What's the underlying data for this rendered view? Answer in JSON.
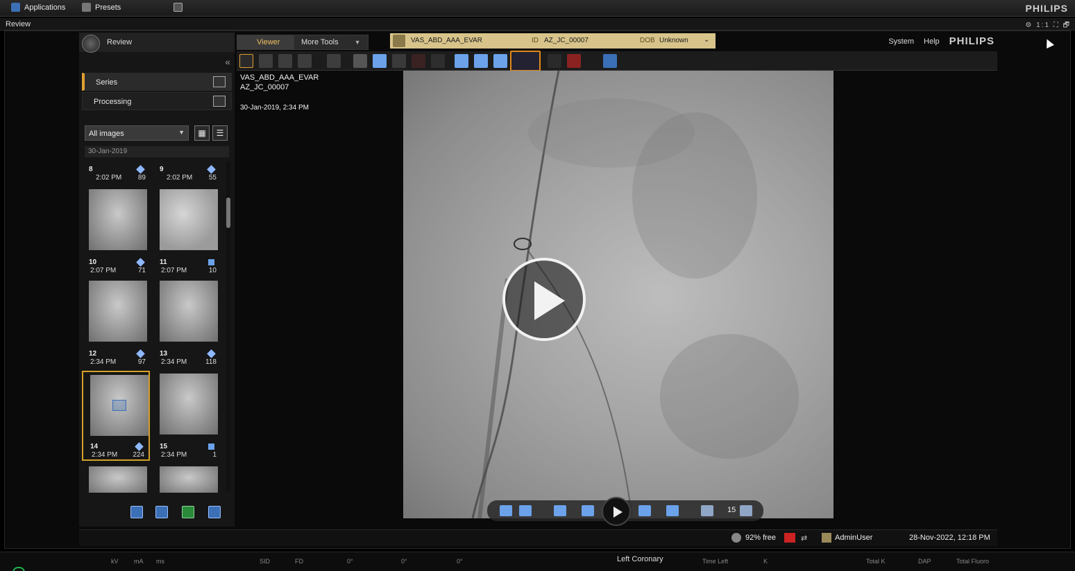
{
  "topbar": {
    "applications": "Applications",
    "presets": "Presets",
    "brand": "PHILIPS"
  },
  "reviewbar": {
    "label": "Review",
    "controls": "⚙ 1:1 ⛶ 🗗"
  },
  "left_panel": {
    "title": "Review",
    "nav": [
      {
        "label": "Series"
      },
      {
        "label": "Processing"
      }
    ],
    "filter": "All images",
    "date": "30-Jan-2019",
    "thumbs": [
      {
        "num": "8",
        "time": "2:02 PM",
        "count": "89"
      },
      {
        "num": "9",
        "time": "2:02 PM",
        "count": "55"
      },
      {
        "num": "10",
        "time": "2:07 PM",
        "count": "71"
      },
      {
        "num": "11",
        "time": "2:07 PM",
        "count": "10"
      },
      {
        "num": "12",
        "time": "2:34 PM",
        "count": "97"
      },
      {
        "num": "13",
        "time": "2:34 PM",
        "count": "118"
      },
      {
        "num": "14",
        "time": "2:34 PM",
        "count": "224"
      },
      {
        "num": "15",
        "time": "2:34 PM",
        "count": "1"
      }
    ]
  },
  "tabs": {
    "viewer": "Viewer",
    "more_tools": "More Tools"
  },
  "patient": {
    "name": "VAS_ABD_AAA_EVAR",
    "id_label": "ID",
    "id": "AZ_JC_00007",
    "dob_label": "DOB",
    "dob": "Unknown"
  },
  "topright": {
    "system": "System",
    "help": "Help",
    "brand": "PHILIPS"
  },
  "overlay": {
    "line1": "VAS_ABD_AAA_EVAR",
    "line2": "AZ_JC_00007",
    "date": "30-Jan-2019, 2:34 PM"
  },
  "playbar": {
    "frame": "15"
  },
  "status": {
    "disk": "92% free",
    "user": "AdminUser",
    "datetime": "28-Nov-2022, 12:18 PM"
  },
  "bottom": {
    "kv": "kV",
    "ma": "mA",
    "ms": "ms",
    "sid": "SID",
    "fd": "FD",
    "angle1": "0°",
    "angle2": "0°",
    "angle3": "0°",
    "left_coronary": "Left Coronary",
    "time_left": "Time Left",
    "k": "K",
    "total_k": "Total K",
    "dap": "DAP",
    "total_fluoro": "Total Fluoro"
  },
  "colors": {
    "accent_gold": "#e0a030",
    "highlight_orange": "#e08a1a",
    "tool_blue": "#6ba2ea",
    "patient_bg": "#d8c48a"
  }
}
